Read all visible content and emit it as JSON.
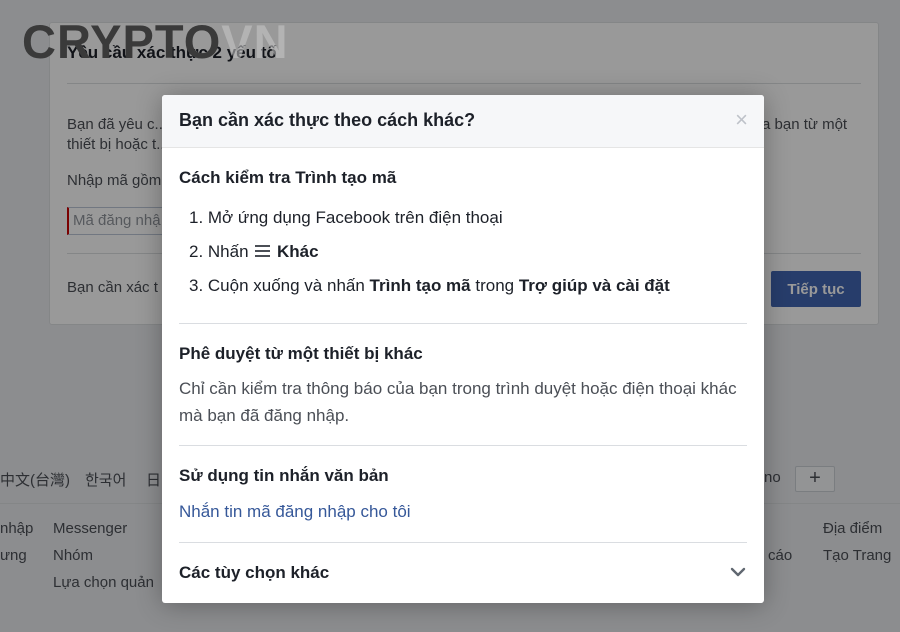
{
  "watermark": {
    "part1": "CRYPTO",
    "part2": "VN"
  },
  "background": {
    "title": "Yêu cầu xác thực 2 yếu tố",
    "desc_left": "Bạn đã yêu c... thiết bị hoặc t...",
    "desc_right": "a bạn từ một",
    "prompt": "Nhập mã gồm",
    "input_placeholder": "Mã đăng nhậ",
    "bottom_text": "Bạn cần xác t",
    "continue_button": "Tiếp tục",
    "languages": [
      "中文(台灣)",
      "한국어",
      "日",
      "no"
    ],
    "footer": {
      "col0": [
        "nhập",
        "ưng"
      ],
      "col1": [
        "Messenger",
        "Nhóm",
        "Lựa chọn quản"
      ],
      "col2": [
        "cáo"
      ],
      "col3": [
        "Địa điểm",
        "Tạo Trang"
      ]
    }
  },
  "dialog": {
    "title": "Bạn cần xác thực theo cách khác?",
    "close_glyph": "×",
    "code_generator": {
      "heading": "Cách kiểm tra Trình tạo mã",
      "step1": "1. Mở ứng dụng Facebook trên điện thoại",
      "step2_prefix": "2. Nhấn",
      "step2_bold": "Khác",
      "step3_prefix": "3. Cuộn xuống và nhấn",
      "step3_bold1": "Trình tạo mã",
      "step3_mid": "trong",
      "step3_bold2": "Trợ giúp và cài đặt"
    },
    "approve": {
      "heading": "Phê duyệt từ một thiết bị khác",
      "text": "Chỉ cần kiểm tra thông báo của bạn trong trình duyệt hoặc điện thoại khác mà bạn đã đăng nhập."
    },
    "sms": {
      "heading": "Sử dụng tin nhắn văn bản",
      "link": "Nhắn tin mã đăng nhập cho tôi"
    },
    "more": {
      "heading": "Các tùy chọn khác"
    }
  },
  "colors": {
    "accent": "#4267b2",
    "link": "#365899",
    "overlay": "rgba(0,0,0,0.4)"
  }
}
